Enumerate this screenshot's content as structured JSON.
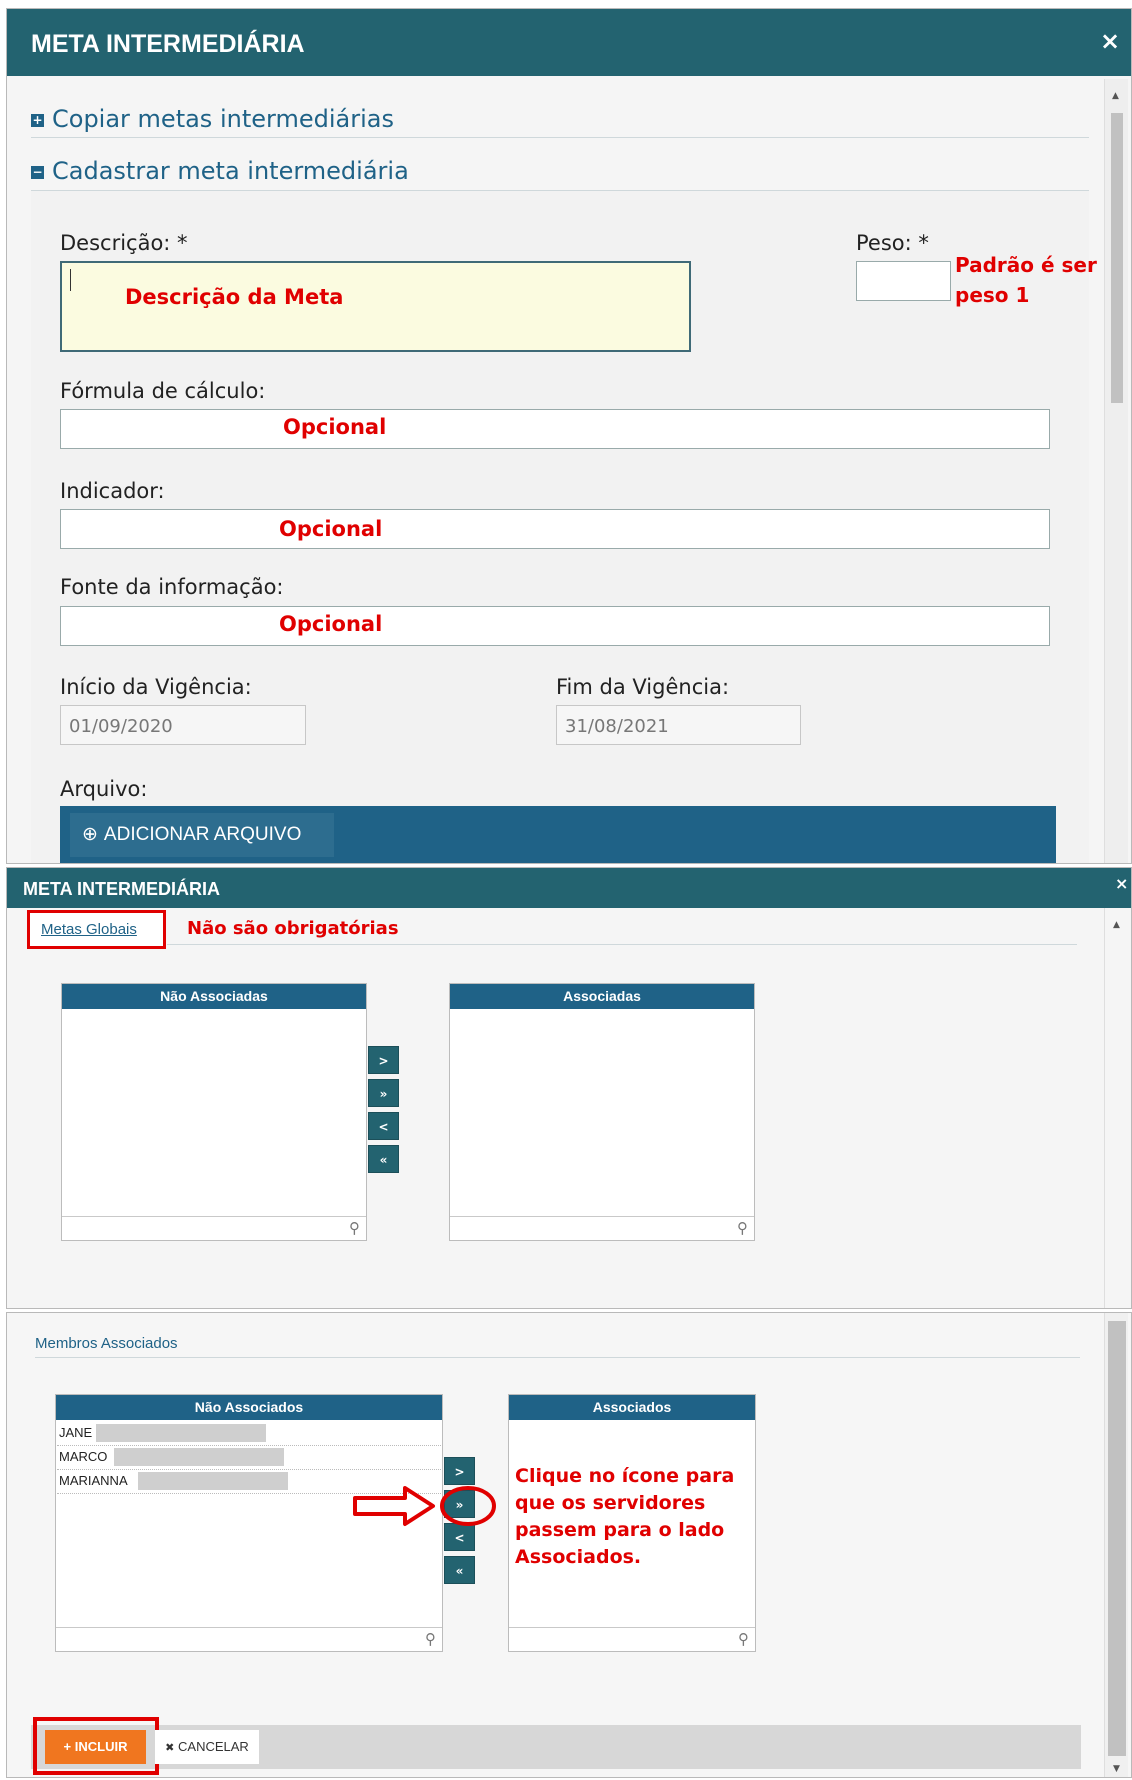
{
  "panel1": {
    "title": "META INTERMEDIÁRIA",
    "close": "×",
    "section_copy": "Copiar metas intermediárias",
    "section_copy_icon": "+",
    "section_register": "Cadastrar meta intermediária",
    "section_register_icon": "−",
    "fields": {
      "descricao_label": "Descrição: *",
      "descricao_note": "Descrição da Meta",
      "peso_label": "Peso: *",
      "peso_note_1": "Padrão é ser",
      "peso_note_2": "peso 1",
      "formula_label": "Fórmula de cálculo:",
      "formula_note": "Opcional",
      "indicador_label": "Indicador:",
      "indicador_note": "Opcional",
      "fonte_label": "Fonte da informação:",
      "fonte_note": "Opcional",
      "inicio_label": "Início da Vigência:",
      "inicio_value": "01/09/2020",
      "fim_label": "Fim da Vigência:",
      "fim_value": "31/08/2021",
      "arquivo_label": "Arquivo:",
      "add_file_button": "ADICIONAR ARQUIVO",
      "add_file_icon": "⊕"
    }
  },
  "panel2": {
    "title": "META INTERMEDIÁRIA",
    "close": "×",
    "tab": "Metas Globais",
    "note": "Não são obrigatórias",
    "left_header": "Não Associadas",
    "right_header": "Associadas",
    "buttons": [
      ">",
      "»",
      "<",
      "«"
    ]
  },
  "panel3": {
    "section": "Membros Associados",
    "left_header": "Não Associados",
    "right_header": "Associados",
    "members": [
      "JANE",
      "MARCO",
      "MARIANNA"
    ],
    "buttons": [
      ">",
      "»",
      "<",
      "«"
    ],
    "instruction_1": "Clique no ícone para",
    "instruction_2": "que os servidores",
    "instruction_3": "passem para o lado",
    "instruction_4": "Associados.",
    "include_button": "INCLUIR",
    "include_icon": "+",
    "cancel_button": "CANCELAR",
    "cancel_icon": "✖"
  },
  "colors": {
    "header": "#236370",
    "list_header": "#1f6287",
    "include_button": "#f0761f",
    "annotation_red": "#e00000"
  },
  "search_icon": "search-icon"
}
